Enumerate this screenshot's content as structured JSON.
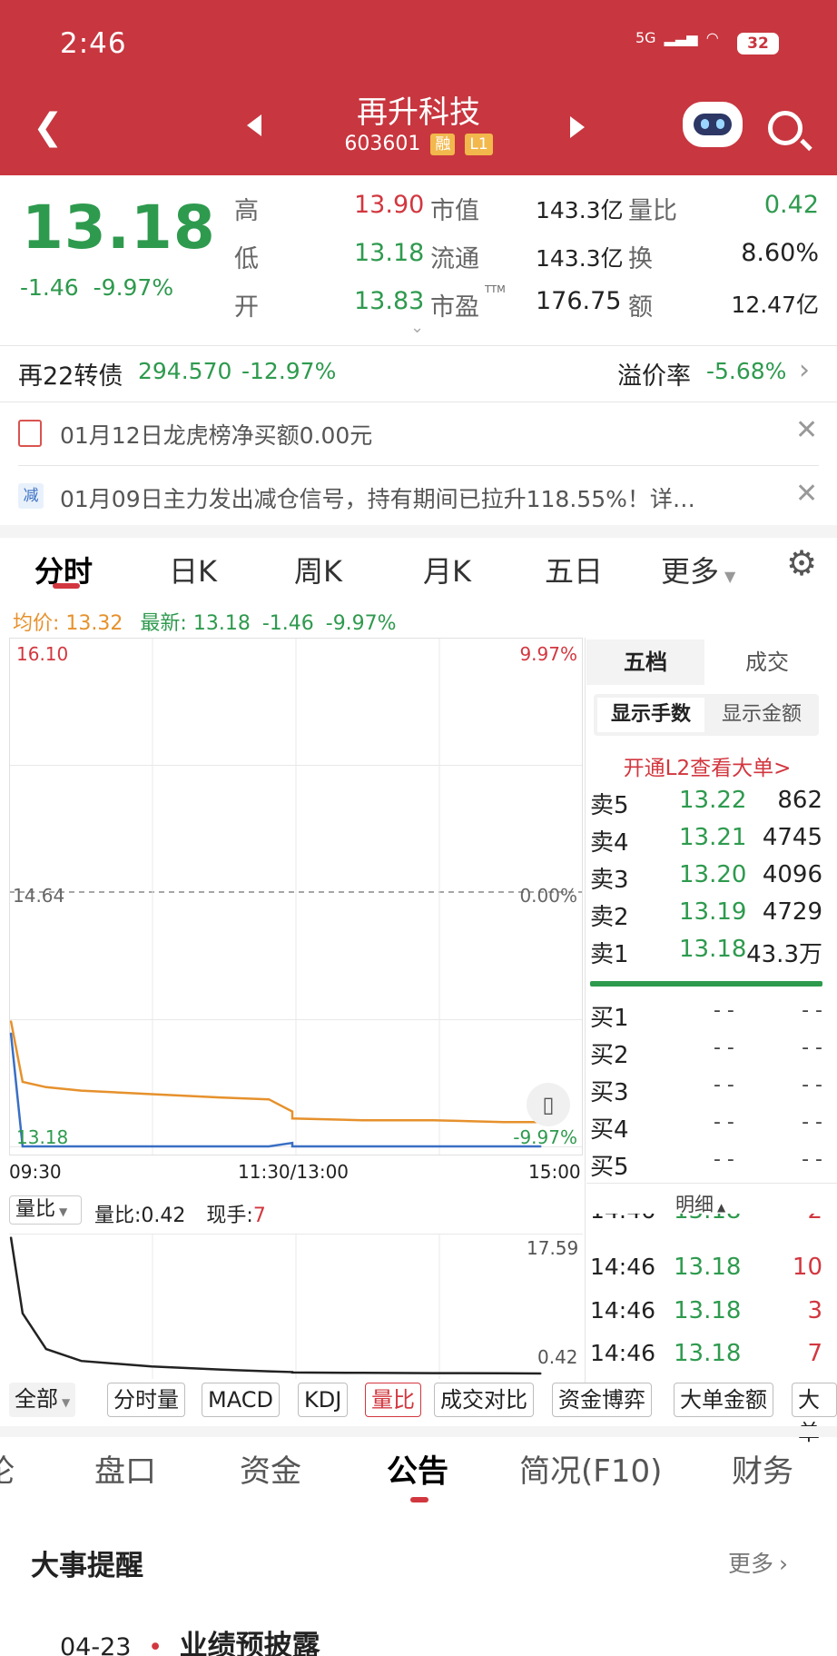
{
  "status_bar": {
    "time": "2:46",
    "network": "5G",
    "battery": "32"
  },
  "header": {
    "title": "再升科技",
    "code": "603601",
    "tag_margin": "融",
    "tag_level": "L1"
  },
  "quote": {
    "price": "13.18",
    "change": "-1.46",
    "change_pct": "-9.97%",
    "high_label": "高",
    "high": "13.90",
    "low_label": "低",
    "low": "13.18",
    "open_label": "开",
    "open": "13.83",
    "mktcap_label": "市值",
    "mktcap": "143.3亿",
    "float_label": "流通",
    "float": "143.3亿",
    "pe_label": "市盈",
    "pe_sup": "TTM",
    "pe": "176.75",
    "vol_ratio_label": "量比",
    "vol_ratio": "0.42",
    "turnover_label": "换",
    "turnover": "8.60%",
    "amount_label": "额",
    "amount": "12.47亿"
  },
  "bond": {
    "name": "再22转债",
    "price": "294.570",
    "pct": "-12.97%",
    "premium_label": "溢价率",
    "premium": "-5.68%"
  },
  "notices": [
    {
      "icon": "doc-icon",
      "text": "01月12日龙虎榜净买额0.00元"
    },
    {
      "icon": "减",
      "text": "01月09日主力发出减仓信号，持有期间已拉升118.55%！详…"
    }
  ],
  "chart_tabs": [
    "分时",
    "日K",
    "周K",
    "月K",
    "五日",
    "更多"
  ],
  "intraday": {
    "avg_label": "均价:",
    "avg": "13.32",
    "latest_label": "最新:",
    "latest": "13.18",
    "latest_chg": "-1.46",
    "latest_pct": "-9.97%",
    "y_top": "16.10",
    "y_mid": "14.64",
    "y_bottom": "13.18",
    "pct_top": "9.97%",
    "pct_mid": "0.00%",
    "pct_bottom": "-9.97%",
    "x_labels": [
      "09:30",
      "11:30/13:00",
      "15:00"
    ]
  },
  "chart_data": {
    "type": "line",
    "x": [
      "09:30",
      "09:35",
      "09:45",
      "10:00",
      "10:30",
      "11:00",
      "11:20",
      "11:30",
      "13:00",
      "13:30",
      "14:00",
      "14:30",
      "14:46"
    ],
    "series": [
      {
        "values": [
          13.9,
          13.55,
          13.52,
          13.5,
          13.48,
          13.46,
          13.45,
          13.38,
          13.34,
          13.33,
          13.33,
          13.32,
          13.32
        ]
      },
      {
        "values": [
          13.83,
          13.18,
          13.18,
          13.18,
          13.18,
          13.18,
          13.18,
          13.2,
          13.18,
          13.18,
          13.18,
          13.18,
          13.18
        ]
      }
    ],
    "ylim": [
      13.18,
      16.1
    ],
    "volume_ratio": {
      "values": [
        17.59,
        8.0,
        3.5,
        2.0,
        1.3,
        0.9,
        0.7,
        0.6,
        0.55,
        0.5,
        0.47,
        0.44,
        0.42
      ],
      "ylim": [
        0.42,
        17.59
      ]
    }
  },
  "vol_panel": {
    "selector": "量比",
    "ratio_label": "量比:",
    "ratio": "0.42",
    "now_label": "现手:",
    "now": "7",
    "y_top": "17.59",
    "y_bottom": "0.42"
  },
  "orderbook": {
    "tab_five": "五档",
    "tab_trades": "成交",
    "show_lots": "显示手数",
    "show_amount": "显示金额",
    "l2_link": "开通L2查看大单>",
    "sells": [
      {
        "label": "卖5",
        "price": "13.22",
        "vol": "862"
      },
      {
        "label": "卖4",
        "price": "13.21",
        "vol": "4745"
      },
      {
        "label": "卖3",
        "price": "13.20",
        "vol": "4096"
      },
      {
        "label": "卖2",
        "price": "13.19",
        "vol": "4729"
      },
      {
        "label": "卖1",
        "price": "13.18",
        "vol": "43.3万"
      }
    ],
    "buys": [
      {
        "label": "买1",
        "price": "- -",
        "vol": "- -"
      },
      {
        "label": "买2",
        "price": "- -",
        "vol": "- -"
      },
      {
        "label": "买3",
        "price": "- -",
        "vol": "- -"
      },
      {
        "label": "买4",
        "price": "- -",
        "vol": "- -"
      },
      {
        "label": "买5",
        "price": "- -",
        "vol": "- -"
      }
    ],
    "detail_label": "明细",
    "trades": [
      {
        "time": "14:46",
        "price": "13.18",
        "vol": "2"
      },
      {
        "time": "14:46",
        "price": "13.18",
        "vol": "10"
      },
      {
        "time": "14:46",
        "price": "13.18",
        "vol": "3"
      },
      {
        "time": "14:46",
        "price": "13.18",
        "vol": "7"
      }
    ]
  },
  "indicator_chips": [
    "全部",
    "分时量",
    "MACD",
    "KDJ",
    "量比",
    "成交对比",
    "资金博弈",
    "大单金额",
    "大单"
  ],
  "bottom_tabs": [
    "论",
    "盘口",
    "资金",
    "公告",
    "简况(F10)",
    "财务"
  ],
  "events": {
    "title": "大事提醒",
    "more": "更多",
    "items": [
      {
        "date": "04-23",
        "text": "业绩预披露"
      }
    ]
  },
  "colors": {
    "header": "#c8363f",
    "down": "#2e9a4e",
    "up": "#d2373f",
    "avg_line": "#e6912c",
    "price_line": "#3a6fc4"
  }
}
